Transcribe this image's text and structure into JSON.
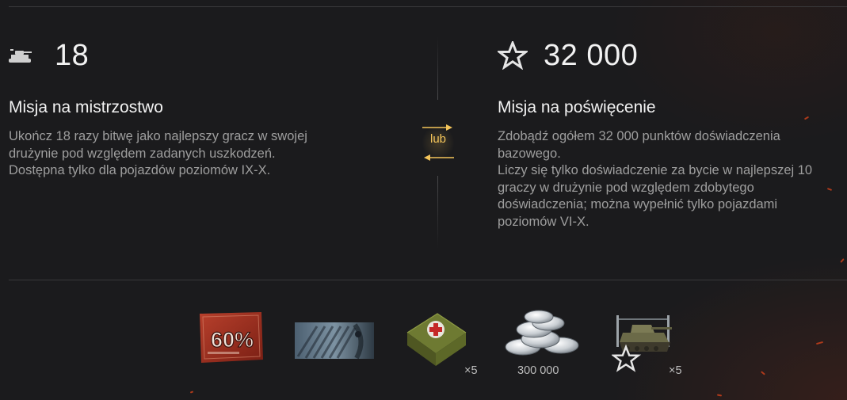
{
  "missions": {
    "left": {
      "icon": "tank-icon",
      "value": "18",
      "title": "Misja na mistrzostwo",
      "description": [
        "Ukończ 18 razy bitwę jako najlepszy gracz w swojej",
        "drużynie pod względem zadanych uszkodzeń.",
        "Dostępna tylko dla pojazdów poziomów IX-X."
      ]
    },
    "right": {
      "icon": "star-outline-icon",
      "value": "32 000",
      "title": "Misja na poświęcenie",
      "description": [
        "Zdobądź ogółem 32 000 punktów doświadczenia",
        "bazowego.",
        "Liczy się tylko doświadczenie za bycie w najlepszej 10",
        "graczy w drużynie pod względem zdobytego",
        "doświadczenia; można wypełnić tylko pojazdami",
        "poziomów VI-X."
      ]
    },
    "separator_label": "lub",
    "separator_color": "#f3c45a"
  },
  "rewards": [
    {
      "name": "discount-coupon-60",
      "icon": "discount-coupon-icon",
      "coupon_text": "60%",
      "qty": ""
    },
    {
      "name": "camouflage-style",
      "icon": "camouflage-style-icon",
      "qty": ""
    },
    {
      "name": "large-repair-kit",
      "icon": "first-aid-kit-icon",
      "qty": "×5"
    },
    {
      "name": "credits",
      "icon": "silver-coins-icon",
      "qty": "300 000"
    },
    {
      "name": "crew-training-booster",
      "icon": "tank-with-star-icon",
      "qty": "×5"
    }
  ],
  "colors": {
    "background": "#1b1b1d",
    "title": "#f2f2f2",
    "description": "#9e9e9e",
    "accent": "#f3c45a",
    "ember": "#d2421c"
  }
}
